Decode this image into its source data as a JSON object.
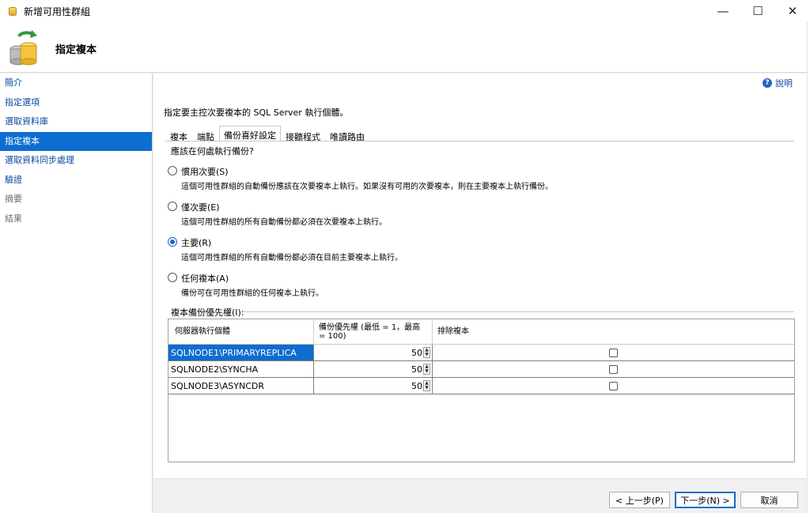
{
  "window": {
    "title": "新增可用性群組",
    "minimize_glyph": "—",
    "maximize_glyph": "☐",
    "close_glyph": "✕"
  },
  "header": {
    "title": "指定複本"
  },
  "help": {
    "label": "說明",
    "icon": "?"
  },
  "sidebar": {
    "items": [
      {
        "label": "簡介"
      },
      {
        "label": "指定選項"
      },
      {
        "label": "選取資料庫"
      },
      {
        "label": "指定複本"
      },
      {
        "label": "選取資料同步處理"
      },
      {
        "label": "驗證"
      },
      {
        "label": "摘要"
      },
      {
        "label": "結果"
      }
    ]
  },
  "main": {
    "instruction": "指定要主控次要複本的 SQL Server 執行個體。",
    "tabs": [
      {
        "label": "複本"
      },
      {
        "label": "端點"
      },
      {
        "label": "備份喜好設定"
      },
      {
        "label": "接聽程式"
      },
      {
        "label": "唯讀路由"
      }
    ],
    "question": "應該在何處執行備份?",
    "options": [
      {
        "label": "慣用次要(S)",
        "desc": "這個可用性群組的自動備份應該在次要複本上執行。如果沒有可用的次要複本，則在主要複本上執行備份。",
        "checked": false
      },
      {
        "label": "僅次要(E)",
        "desc": "這個可用性群組的所有自動備份都必須在次要複本上執行。",
        "checked": false
      },
      {
        "label": "主要(R)",
        "desc": "這個可用性群組的所有自動備份都必須在目前主要複本上執行。",
        "checked": true
      },
      {
        "label": "任何複本(A)",
        "desc": "備份可在可用性群組的任何複本上執行。",
        "checked": false
      }
    ],
    "priority_label": "複本備份優先權(I):",
    "grid": {
      "headers": {
        "instance": "伺服器執行個體",
        "priority": "備份優先權 (最低 = 1，最高 = 100)",
        "exclude": "排除複本"
      },
      "rows": [
        {
          "instance": "SQLNODE1\\PRIMARYREPLICA",
          "priority": "50"
        },
        {
          "instance": "SQLNODE2\\SYNCHA",
          "priority": "50"
        },
        {
          "instance": "SQLNODE3\\ASYNCDR",
          "priority": "50"
        }
      ]
    }
  },
  "footer": {
    "back": "< 上一步(P)",
    "next": "下一步(N) >",
    "cancel": "取消"
  }
}
